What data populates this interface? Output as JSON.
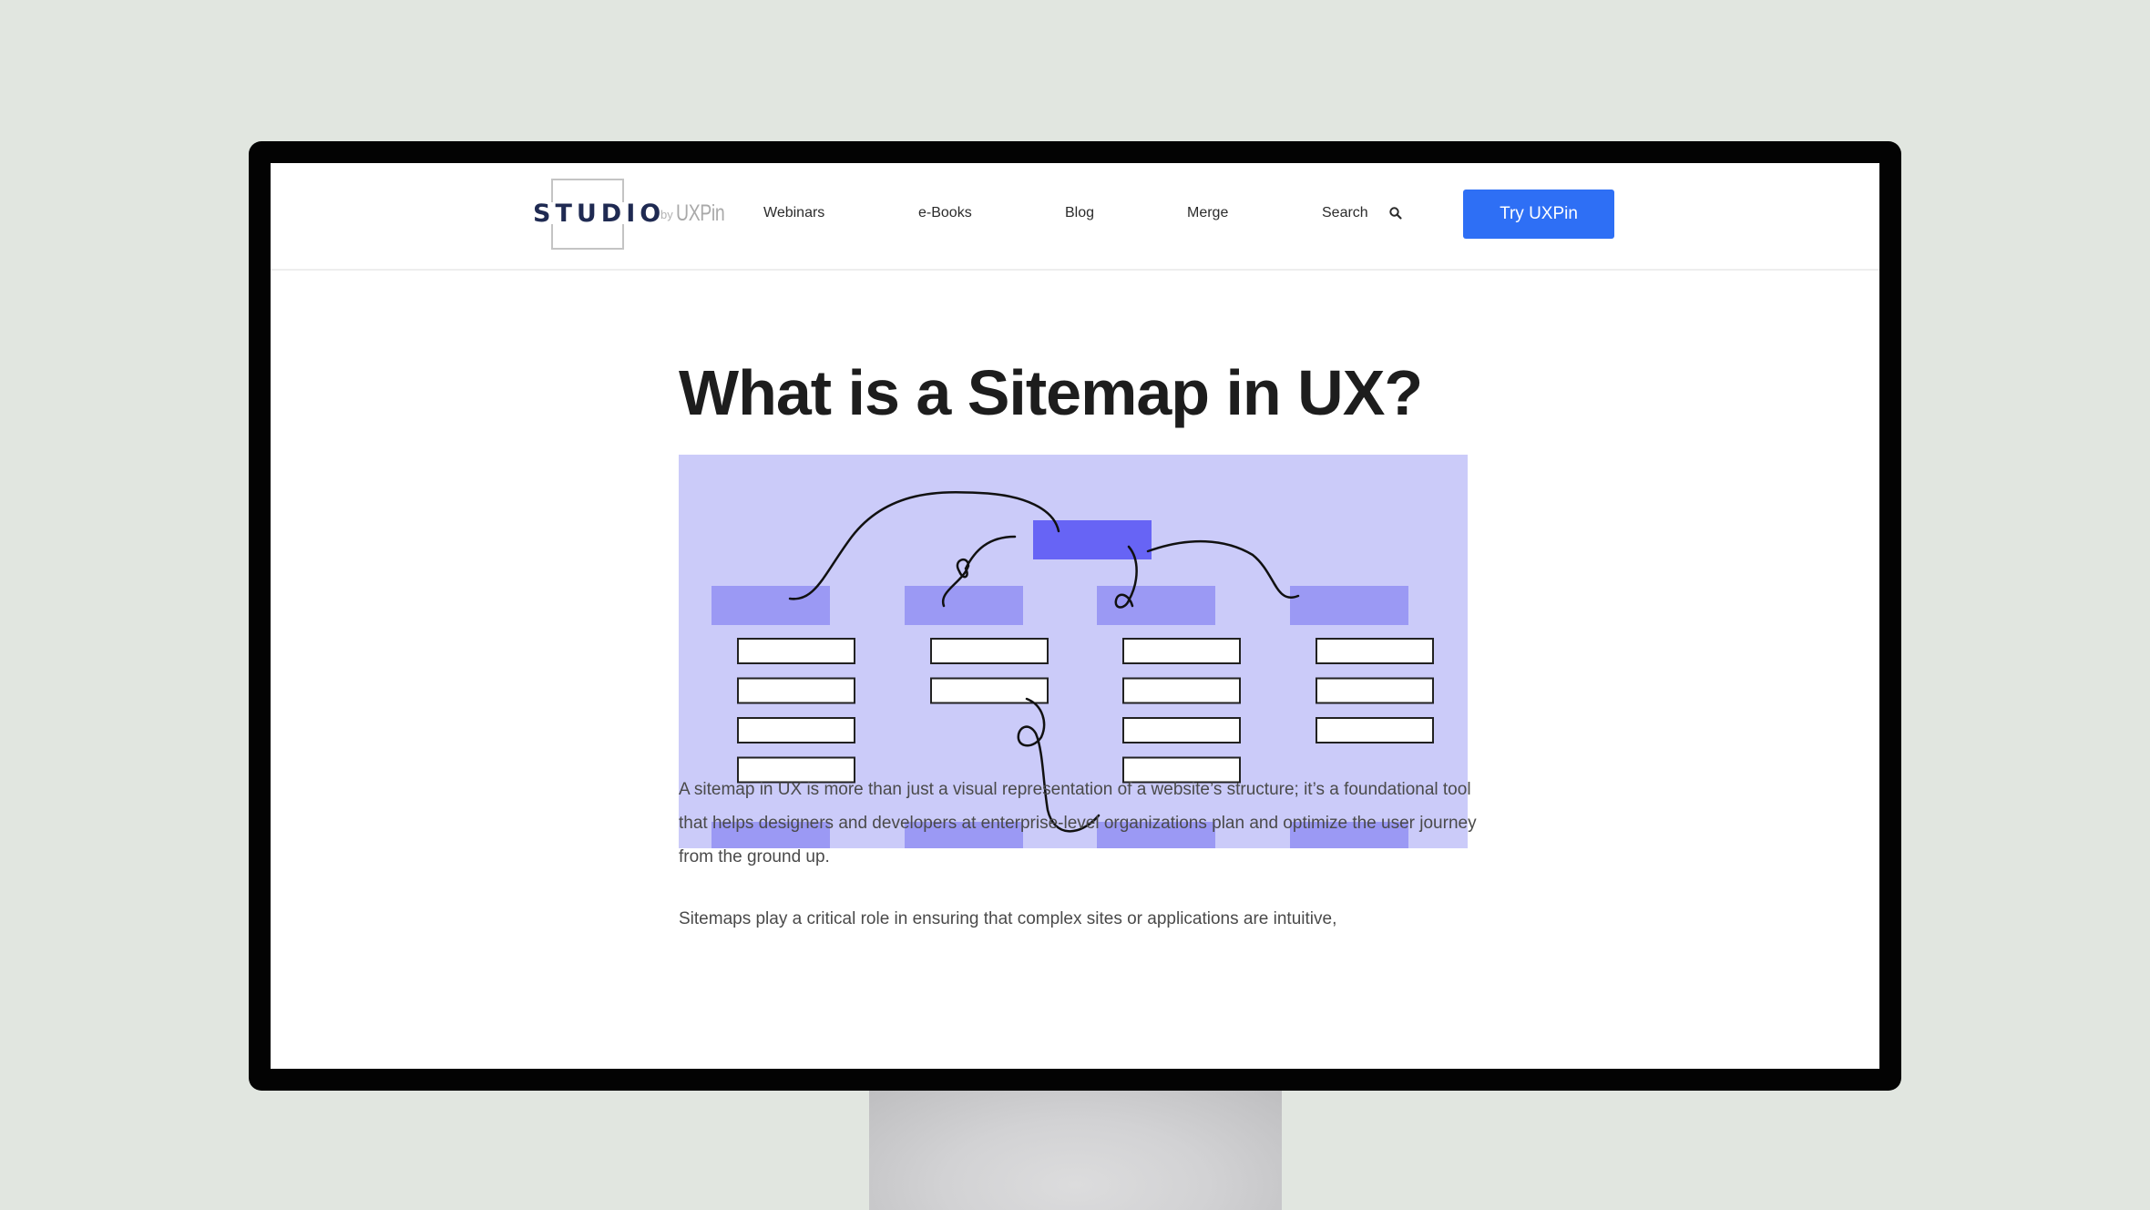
{
  "site": {
    "logo": {
      "wordmark": "STUDIO",
      "by": "by",
      "brand": "UXPin"
    },
    "nav": [
      {
        "label": "Webinars"
      },
      {
        "label": "e-Books"
      },
      {
        "label": "Blog"
      },
      {
        "label": "Merge"
      },
      {
        "label": "Search",
        "icon": "search-icon"
      }
    ],
    "cta_label": "Try UXPin",
    "colors": {
      "cta": "#2e6ff5",
      "logo_text": "#1f2a52",
      "hero_bg": "#cbcbf9",
      "hero_root": "#6764f5",
      "hero_section": "#9b99f4"
    }
  },
  "article": {
    "title": "What is a Sitemap in UX?",
    "hero_illustration": {
      "description": "Sitemap diagram: one root node linked by hand-drawn curves to four section nodes, each with child page boxes",
      "sections": [
        {
          "children": 4
        },
        {
          "children": 2
        },
        {
          "children": 4
        },
        {
          "children": 3
        }
      ],
      "bottom_nodes": 4
    },
    "paragraphs": [
      "A sitemap in UX is more than just a visual representation of a website’s structure; it’s a foundational tool that helps designers and developers at enterprise-level organizations plan and optimize the user journey from the ground up.",
      "Sitemaps play a critical role in ensuring that complex sites or applications are intuitive,"
    ]
  }
}
